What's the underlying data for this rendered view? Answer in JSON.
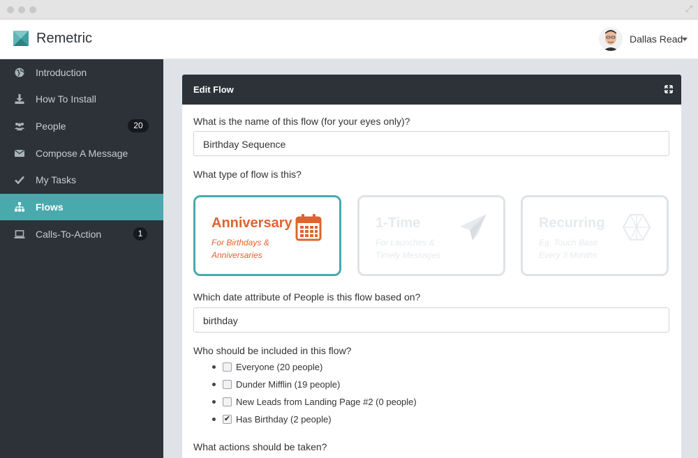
{
  "app": {
    "brand": "Remetric",
    "accent": "#49a9ad",
    "selected_accent": "#e0632e"
  },
  "user": {
    "name": "Dallas Read"
  },
  "sidebar": {
    "items": [
      {
        "label": "Introduction",
        "icon": "globe-icon"
      },
      {
        "label": "How To Install",
        "icon": "download-icon"
      },
      {
        "label": "People",
        "icon": "users-icon",
        "badge": "20"
      },
      {
        "label": "Compose A Message",
        "icon": "envelope-icon"
      },
      {
        "label": "My Tasks",
        "icon": "checkmark-icon"
      },
      {
        "label": "Flows",
        "icon": "sitemap-icon",
        "active": true
      },
      {
        "label": "Calls-To-Action",
        "icon": "laptop-icon",
        "badge": "1"
      }
    ]
  },
  "panel": {
    "title": "Edit Flow"
  },
  "form": {
    "name_question": "What is the name of this flow (for your eyes only)?",
    "name_value": "Birthday Sequence",
    "type_question": "What type of flow is this?",
    "types": [
      {
        "title": "Anniversary",
        "subtitle": "For Birthdays & Anniversaries",
        "icon": "calendar-icon",
        "selected": true
      },
      {
        "title": "1-Time",
        "subtitle": "For Launches & Timely Messages",
        "icon": "paper-plane-icon",
        "selected": false
      },
      {
        "title": "Recurring",
        "subtitle": "Eg. Touch Base Every 3 Months",
        "icon": "hexagon-icon",
        "selected": false
      }
    ],
    "date_question": "Which date attribute of People is this flow based on?",
    "date_value": "birthday",
    "include_question": "Who should be included in this flow?",
    "segments": [
      {
        "label": "Everyone (20 people)",
        "checked": false
      },
      {
        "label": "Dunder Mifflin (19 people)",
        "checked": false
      },
      {
        "label": "New Leads from Landing Page #2 (0 people)",
        "checked": false
      },
      {
        "label": "Has Birthday (2 people)",
        "checked": true
      }
    ],
    "actions_question": "What actions should be taken?"
  }
}
